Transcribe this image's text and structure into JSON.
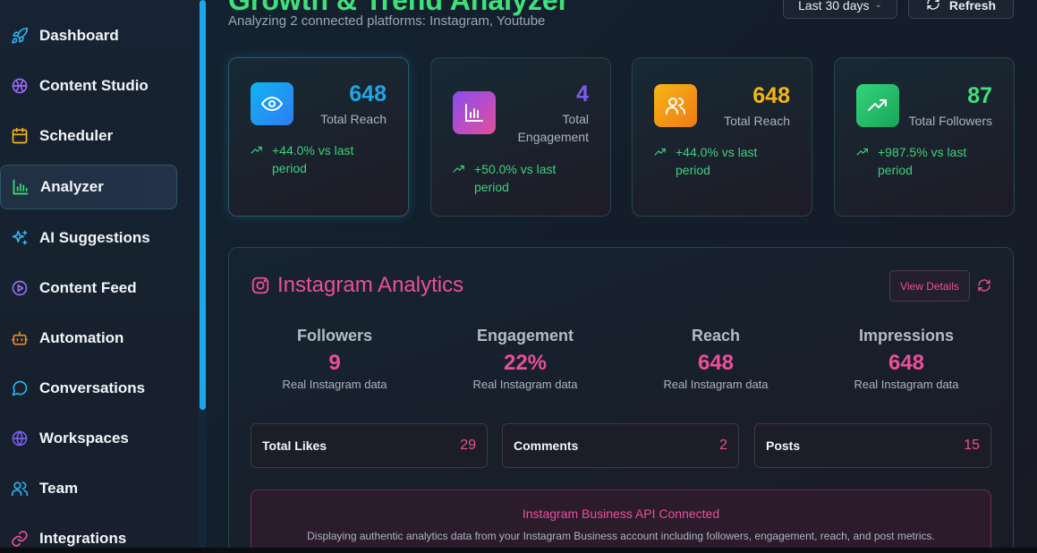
{
  "sidebar": {
    "items": [
      {
        "label": "Dashboard",
        "icon": "rocket-icon"
      },
      {
        "label": "Content Studio",
        "icon": "palette-icon"
      },
      {
        "label": "Scheduler",
        "icon": "calendar-icon"
      },
      {
        "label": "Analyzer",
        "icon": "bar-chart-icon",
        "active": true
      },
      {
        "label": "AI Suggestions",
        "icon": "sparkles-icon"
      },
      {
        "label": "Content Feed",
        "icon": "play-circle-icon"
      },
      {
        "label": "Automation",
        "icon": "bot-icon"
      },
      {
        "label": "Conversations",
        "icon": "chat-bubble-icon"
      },
      {
        "label": "Workspaces",
        "icon": "globe-icon"
      },
      {
        "label": "Team",
        "icon": "users-icon"
      },
      {
        "label": "Integrations",
        "icon": "link-icon"
      }
    ]
  },
  "header": {
    "title": "Growth & Trend Analyzer",
    "subtitle": "Analyzing 2 connected platforms: Instagram, Youtube",
    "range_label": "Last 30 days",
    "refresh_label": "Refresh"
  },
  "stats": [
    {
      "value": "648",
      "label": "Total Reach",
      "change": "+44.0% vs last period",
      "color": "#1ea7e8",
      "icon": "eye-icon"
    },
    {
      "value": "4",
      "label": "Total Engagement",
      "change": "+50.0% vs last period",
      "color": "#7b5cf0",
      "icon": "bar-chart-icon"
    },
    {
      "value": "648",
      "label": "Total Reach",
      "change": "+44.0% vs last period",
      "color": "#f5b614",
      "icon": "users-icon"
    },
    {
      "value": "87",
      "label": "Total Followers",
      "change": "+987.5% vs last period",
      "color": "#3ee27a",
      "icon": "trending-up-icon"
    }
  ],
  "instagram": {
    "title": "Instagram Analytics",
    "view_details": "View Details",
    "metrics": [
      {
        "name": "Followers",
        "value": "9",
        "note": "Real Instagram data"
      },
      {
        "name": "Engagement",
        "value": "22%",
        "note": "Real Instagram data"
      },
      {
        "name": "Reach",
        "value": "648",
        "note": "Real Instagram data"
      },
      {
        "name": "Impressions",
        "value": "648",
        "note": "Real Instagram data"
      }
    ],
    "totals": [
      {
        "label": "Total Likes",
        "value": "29"
      },
      {
        "label": "Comments",
        "value": "2"
      },
      {
        "label": "Posts",
        "value": "15"
      }
    ],
    "api_title": "Instagram Business API Connected",
    "api_desc": "Displaying authentic analytics data from your Instagram Business account including followers, engagement, reach, and post metrics."
  },
  "colors": {
    "accent_green": "#3ee27a",
    "instagram_pink": "#ec4e9a",
    "scroll_blue": "#1ea7e8"
  }
}
